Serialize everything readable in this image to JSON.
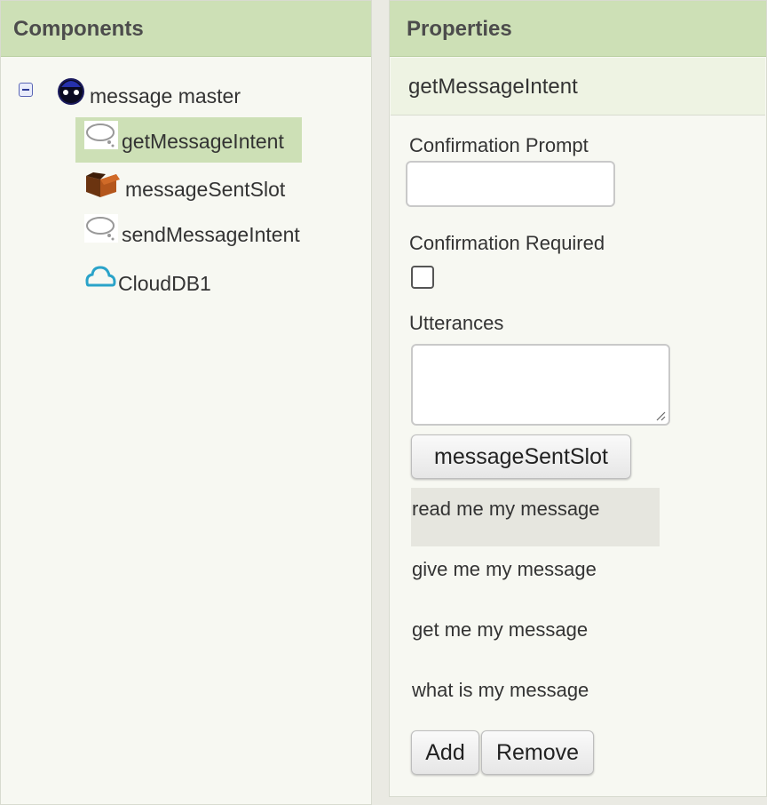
{
  "components_panel": {
    "header": "Components",
    "tree": {
      "root": {
        "label": "message master",
        "icon": "android-robot-icon",
        "collapse_icon": "minus"
      },
      "children": [
        {
          "label": "getMessageIntent",
          "icon": "speech-bubble-icon",
          "selected": true
        },
        {
          "label": "messageSentSlot",
          "icon": "box-icon",
          "selected": false
        },
        {
          "label": "sendMessageIntent",
          "icon": "speech-bubble-icon",
          "selected": false
        },
        {
          "label": "CloudDB1",
          "icon": "cloud-icon",
          "selected": false
        }
      ]
    }
  },
  "properties_panel": {
    "header": "Properties",
    "component_name": "getMessageIntent",
    "confirmation_prompt": {
      "label": "Confirmation Prompt",
      "value": ""
    },
    "confirmation_required": {
      "label": "Confirmation Required",
      "checked": false
    },
    "utterances": {
      "label": "Utterances",
      "value": "",
      "slot_button": "messageSentSlot",
      "items": [
        {
          "text": "read me my message",
          "selected": true
        },
        {
          "text": "give me my message",
          "selected": false
        },
        {
          "text": "get me my message",
          "selected": false
        },
        {
          "text": "what is my message",
          "selected": false
        }
      ],
      "add_button": "Add",
      "remove_button": "Remove"
    }
  },
  "colors": {
    "header_bg": "#cde0b6",
    "panel_bg": "#f7f8f2",
    "selected_item": "#cde0b6",
    "selected_utterance": "#e6e6df"
  }
}
